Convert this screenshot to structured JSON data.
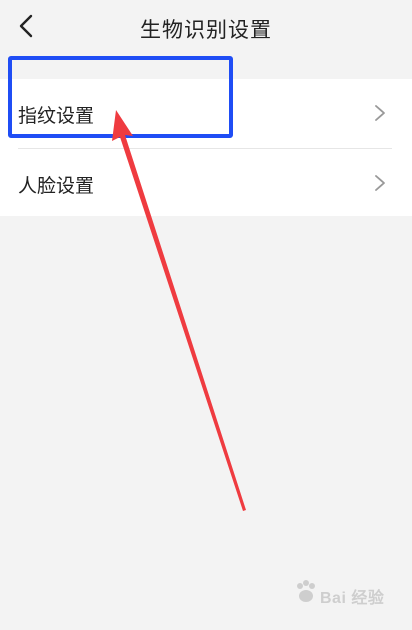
{
  "header": {
    "title": "生物识别设置",
    "back_icon": "chevron-left-icon"
  },
  "list": {
    "items": [
      {
        "label": "指纹设置",
        "icon": "chevron-right-icon"
      },
      {
        "label": "人脸设置",
        "icon": "chevron-right-icon"
      }
    ]
  },
  "annotation": {
    "highlight_color": "#1f4df5",
    "arrow_color": "#ef3b40"
  },
  "watermark": {
    "text": "Bai 经验"
  }
}
